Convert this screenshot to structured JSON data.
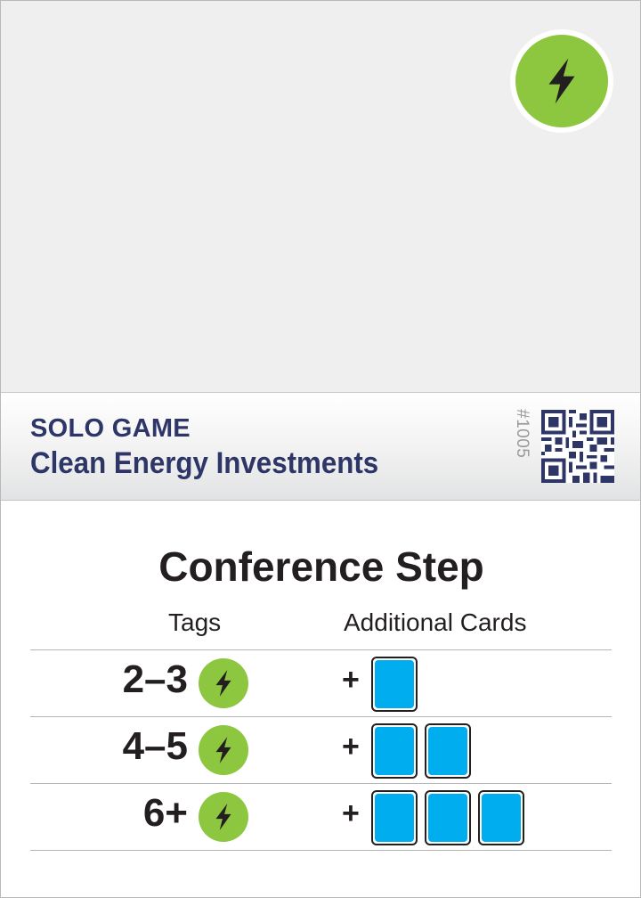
{
  "card": {
    "mode_label": "SOLO GAME",
    "title": "Clean Energy Investments",
    "card_number": "#1005",
    "badge_icon": "power-bolt-icon",
    "colors": {
      "title_text": "#2e3567",
      "power_green": "#8dc63f",
      "card_blue": "#00aeef",
      "art_background": "#efefef"
    }
  },
  "conference": {
    "heading": "Conference Step",
    "col_tags": "Tags",
    "col_cards": "Additional Cards",
    "rows": [
      {
        "range": "2–3",
        "tag_icon": "power-bolt-icon",
        "plus": "+",
        "cards": 1
      },
      {
        "range": "4–5",
        "tag_icon": "power-bolt-icon",
        "plus": "+",
        "cards": 2
      },
      {
        "range": "6+",
        "tag_icon": "power-bolt-icon",
        "plus": "+",
        "cards": 3
      }
    ]
  }
}
